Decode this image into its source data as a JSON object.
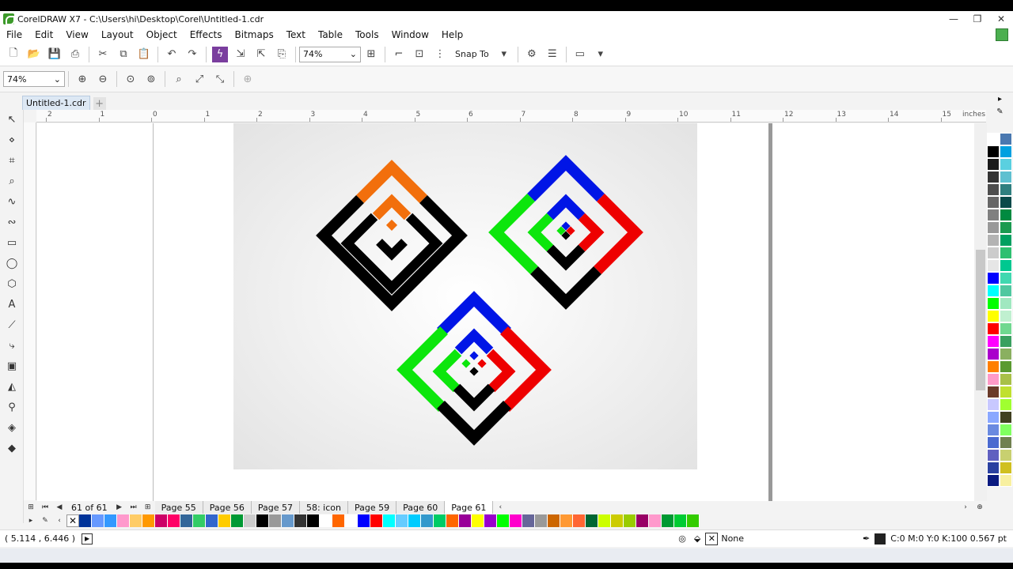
{
  "window": {
    "title": "CorelDRAW X7 - C:\\Users\\hi\\Desktop\\Corel\\Untitled-1.cdr",
    "minimize": "—",
    "restore": "❐",
    "close": "✕"
  },
  "menu": [
    "File",
    "Edit",
    "View",
    "Layout",
    "Object",
    "Effects",
    "Bitmaps",
    "Text",
    "Table",
    "Tools",
    "Window",
    "Help"
  ],
  "toolbar": {
    "zoom": "74%",
    "snap": "Snap To"
  },
  "propbar": {
    "zoom": "74%"
  },
  "doc_tab": {
    "label": "Untitled-1.cdr",
    "add": "+"
  },
  "ruler": {
    "labels": [
      "2",
      "1",
      "0",
      "1",
      "2",
      "3",
      "4",
      "5",
      "6",
      "7",
      "8",
      "9",
      "10",
      "11",
      "12",
      "13",
      "14",
      "15"
    ],
    "unit": "inches"
  },
  "pages": {
    "count": "61 of 61",
    "tabs": [
      "Page 55",
      "Page 56",
      "Page 57",
      "58: icon",
      "Page 59",
      "Page 60",
      "Page 61"
    ],
    "active": "Page 61"
  },
  "status": {
    "coords": "( 5.114 , 6.446 )",
    "fill": "None",
    "outline": "C:0 M:0 Y:0 K:100  0.567 pt"
  },
  "colors": {
    "orange": "#f26f0c",
    "black": "#000000",
    "blue": "#0015e6",
    "green": "#0ce60c",
    "red": "#ee0000"
  },
  "palette_colors": [
    "#ffffff",
    "#4a78b0",
    "#000000",
    "#00a0e0",
    "#1a1a1a",
    "#5ad0e0",
    "#333333",
    "#5fc0d0",
    "#4d4d4d",
    "#2f7f7f",
    "#666666",
    "#0a4a4a",
    "#808080",
    "#008a40",
    "#999999",
    "#1a9a50",
    "#b3b3b3",
    "#00a060",
    "#cccccc",
    "#2ec070",
    "#e6e6e6",
    "#00c890",
    "#0000ff",
    "#40d8b0",
    "#00ffff",
    "#50c8a0",
    "#00ff00",
    "#a0e8c0",
    "#ffff00",
    "#c0f0d0",
    "#ff0000",
    "#70d890",
    "#ff00ff",
    "#3aa060",
    "#aa00cc",
    "#8ab060",
    "#ff7f00",
    "#5a9a30",
    "#ff9ac8",
    "#a8c048",
    "#6a3a2a",
    "#c0e030",
    "#c8c8ff",
    "#a0ff30",
    "#8aa8ff",
    "#404020",
    "#6a8ae0",
    "#80ff60",
    "#4a6ad0",
    "#708050",
    "#6060c0",
    "#c8d070",
    "#2a40a0",
    "#d0c020",
    "#0a1a80",
    "#f8f0a0"
  ],
  "color_strip": [
    "#003399",
    "#6699ff",
    "#3399ff",
    "#ff99cc",
    "#ffcc66",
    "#ff9900",
    "#cc0066",
    "#ff0066",
    "#336699",
    "#33cc66",
    "#3366cc",
    "#ffcc00",
    "#009933",
    "#cccccc",
    "#000000",
    "#999999",
    "#6699cc",
    "#333333",
    "#000000",
    "#ffffff",
    "#ff6600",
    "#ffffff",
    "#0000ff",
    "#ff0000",
    "#00ffff",
    "#66ccff",
    "#00ccff",
    "#3399cc",
    "#00cc66",
    "#ff6600",
    "#990099",
    "#ffff00",
    "#9900cc",
    "#00ff00",
    "#ff00cc",
    "#666699",
    "#999999",
    "#cc6600",
    "#ff9933",
    "#ff6633",
    "#006633",
    "#ccff00",
    "#cccc00",
    "#99cc00",
    "#990066",
    "#ff99cc",
    "#009933",
    "#00cc33",
    "#33cc00"
  ]
}
